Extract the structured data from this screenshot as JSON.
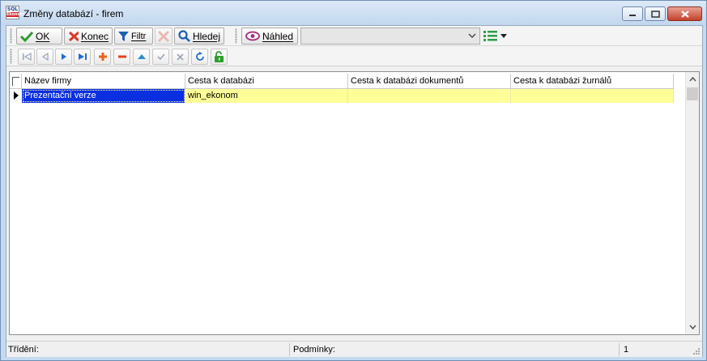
{
  "window": {
    "title": "Změny databází - firem",
    "icon_top": "SQL",
    "icon_bottom": "Ekonom"
  },
  "toolbar": {
    "ok_label": "OK",
    "konec_label": "Konec",
    "filtr_label": "Filtr",
    "hledej_label": "Hledej",
    "nahled_label": "Náhled",
    "combo_value": ""
  },
  "grid": {
    "columns": [
      "Název firmy",
      "Cesta k databázi",
      "Cesta k databázi dokumentů",
      "Cesta k databázi žurnálů"
    ],
    "rows": [
      [
        "Prezentační verze",
        "win_ekonom",
        "",
        ""
      ]
    ]
  },
  "status": {
    "trideni_label": "Třídění:",
    "podminky_label": "Podmínky:",
    "count": "1"
  },
  "colors": {
    "row_highlight": "#ffff99",
    "selection": "#0a2fe0",
    "ok_green": "#2e9e2e",
    "close_red": "#d83a2a",
    "filter_blue": "#1f5fb3"
  }
}
